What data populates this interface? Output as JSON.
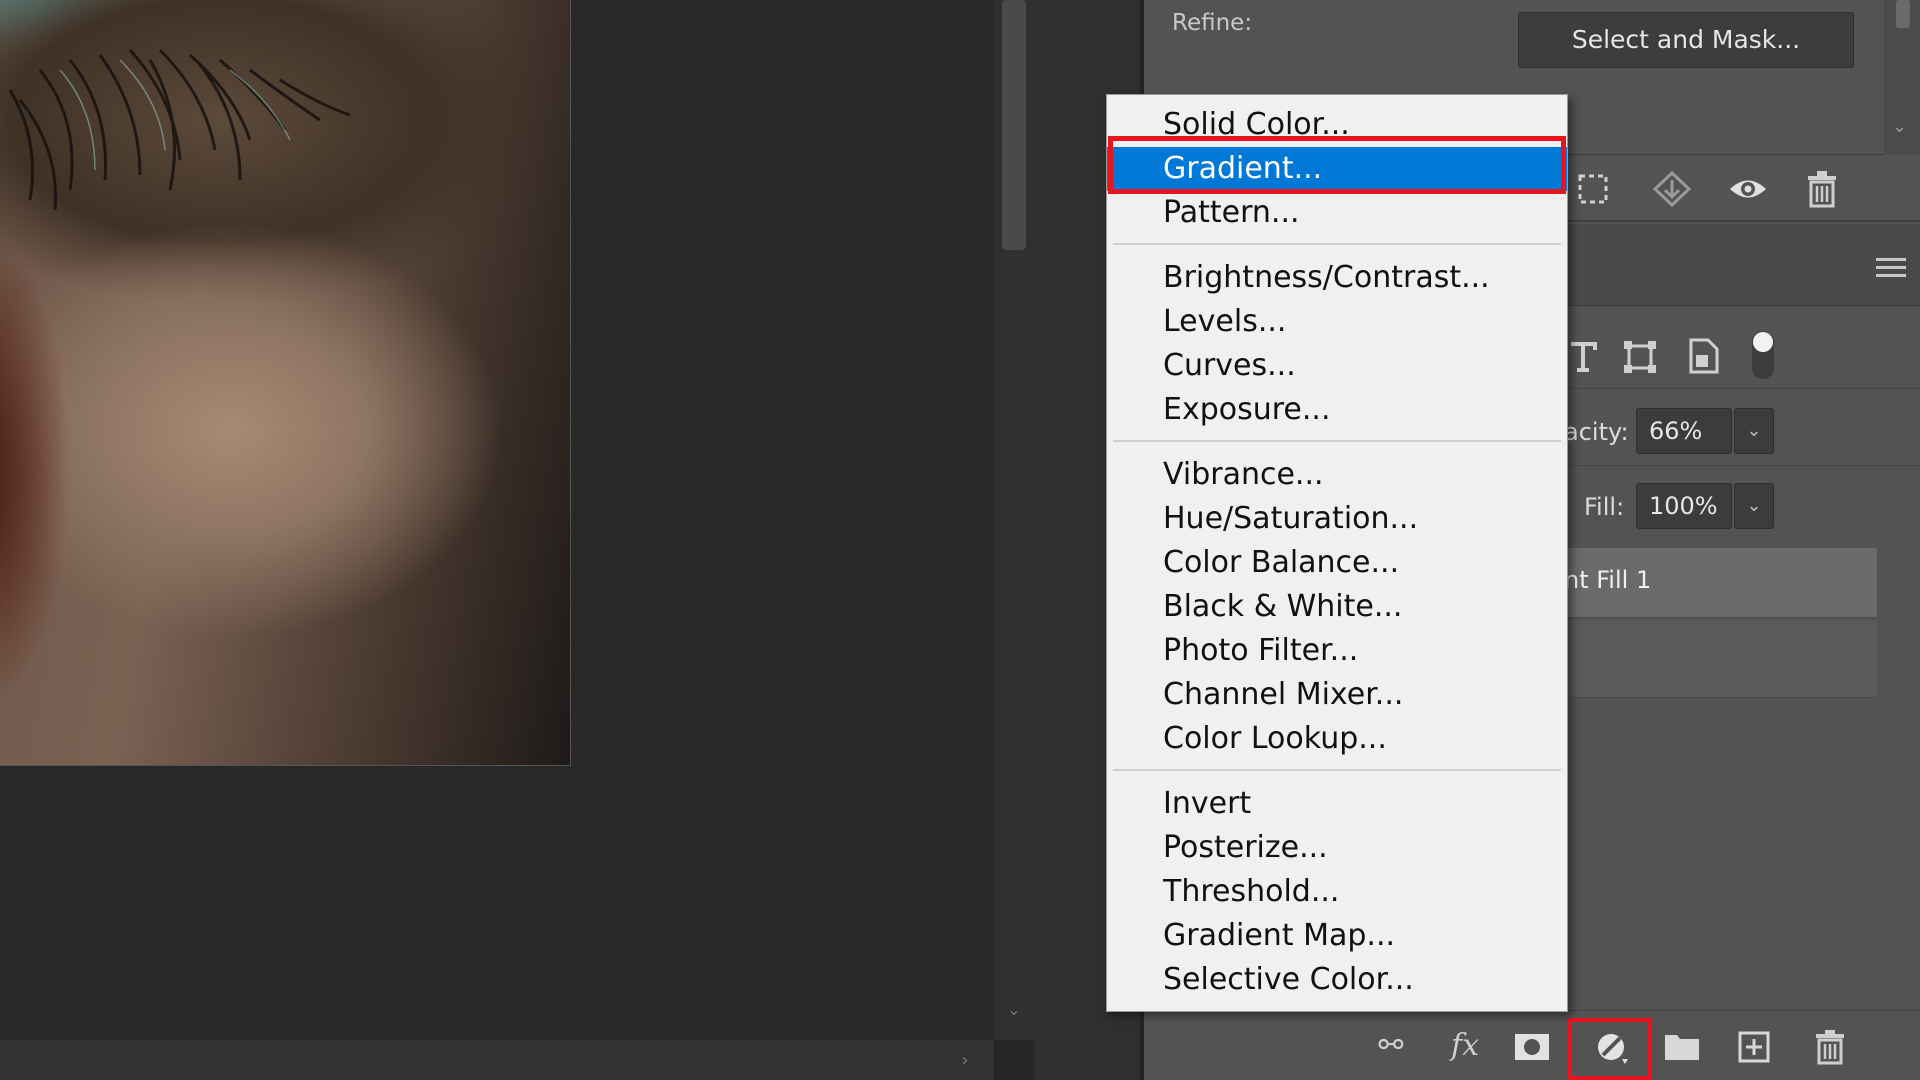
{
  "app": {
    "name": "Photoshop layers adjustment menu"
  },
  "panel": {
    "refine_label": "Refine:",
    "select_and_mask": "Select and Mask...",
    "opacity_label": "acity:",
    "opacity_value": "66%",
    "fill_label": "Fill:",
    "fill_value": "100%",
    "layer_name": "nt Fill 1"
  },
  "menu": {
    "groups": [
      [
        "Solid Color...",
        "Gradient...",
        "Pattern..."
      ],
      [
        "Brightness/Contrast...",
        "Levels...",
        "Curves...",
        "Exposure..."
      ],
      [
        "Vibrance...",
        "Hue/Saturation...",
        "Color Balance...",
        "Black & White...",
        "Photo Filter...",
        "Channel Mixer...",
        "Color Lookup..."
      ],
      [
        "Invert",
        "Posterize...",
        "Threshold...",
        "Gradient Map...",
        "Selective Color..."
      ]
    ],
    "highlighted": "Gradient..."
  },
  "colors": {
    "highlight": "#0078d7",
    "annotation": "#e8141e",
    "panel": "#535353",
    "menu_bg": "#f0f0f0"
  },
  "icons": {
    "row1": [
      "selection-marquee-icon",
      "move-diamond-icon",
      "eye-icon",
      "trash-icon"
    ],
    "filter": [
      "type-icon",
      "transform-icon",
      "smart-object-icon",
      "toggle-icon"
    ],
    "bottom": [
      "link-icon",
      "fx-icon",
      "mask-icon",
      "adjustment-layer-icon",
      "folder-icon",
      "new-layer-icon",
      "trash-icon"
    ]
  }
}
